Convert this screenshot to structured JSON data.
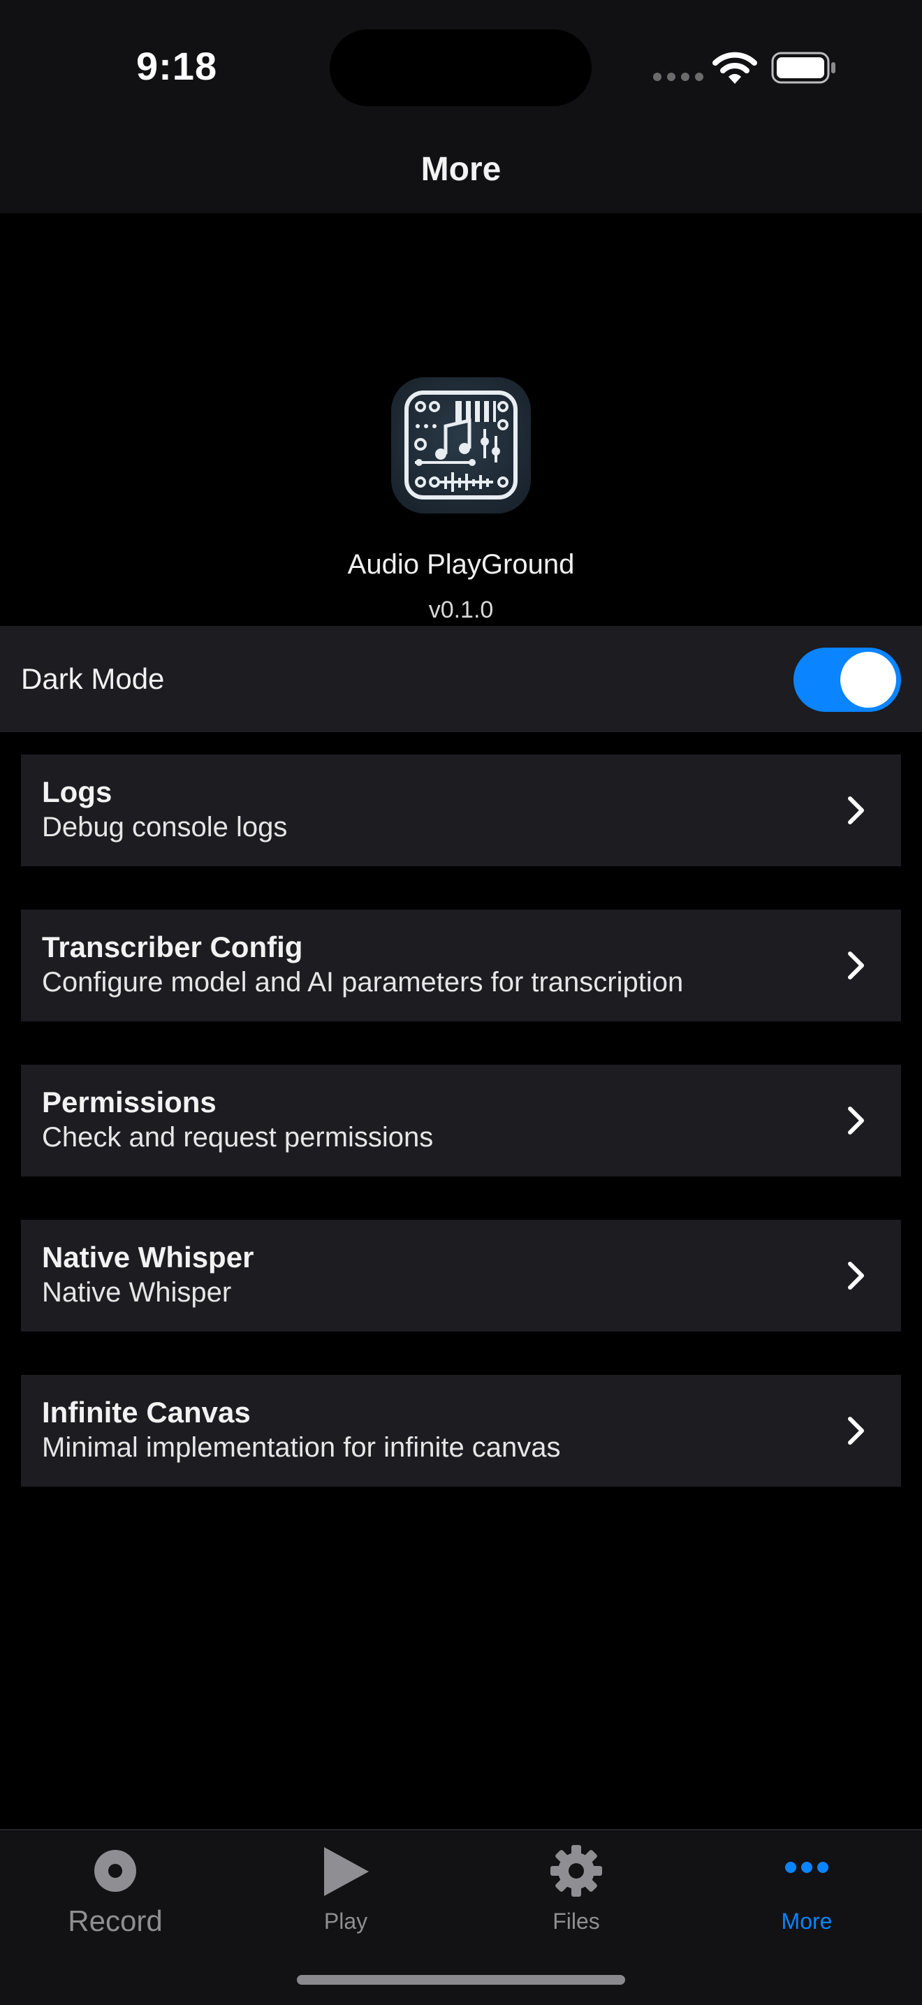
{
  "status_bar": {
    "time": "9:18"
  },
  "nav": {
    "title": "More"
  },
  "app": {
    "name": "Audio PlayGround",
    "version": "v0.1.0"
  },
  "settings": {
    "dark_mode_label": "Dark Mode",
    "dark_mode_on": true,
    "accent_color": "#0a84ff"
  },
  "menu": [
    {
      "title": "Logs",
      "subtitle": "Debug console logs"
    },
    {
      "title": "Transcriber Config",
      "subtitle": "Configure model and AI parameters for transcription"
    },
    {
      "title": "Permissions",
      "subtitle": "Check and request permissions"
    },
    {
      "title": "Native Whisper",
      "subtitle": "Native Whisper"
    },
    {
      "title": "Infinite Canvas",
      "subtitle": "Minimal implementation for infinite canvas"
    }
  ],
  "tabs": [
    {
      "label": "Record",
      "icon": "record-icon",
      "active": false
    },
    {
      "label": "Play",
      "icon": "play-icon",
      "active": false
    },
    {
      "label": "Files",
      "icon": "gear-icon",
      "active": false
    },
    {
      "label": "More",
      "icon": "more-icon",
      "active": true
    }
  ]
}
